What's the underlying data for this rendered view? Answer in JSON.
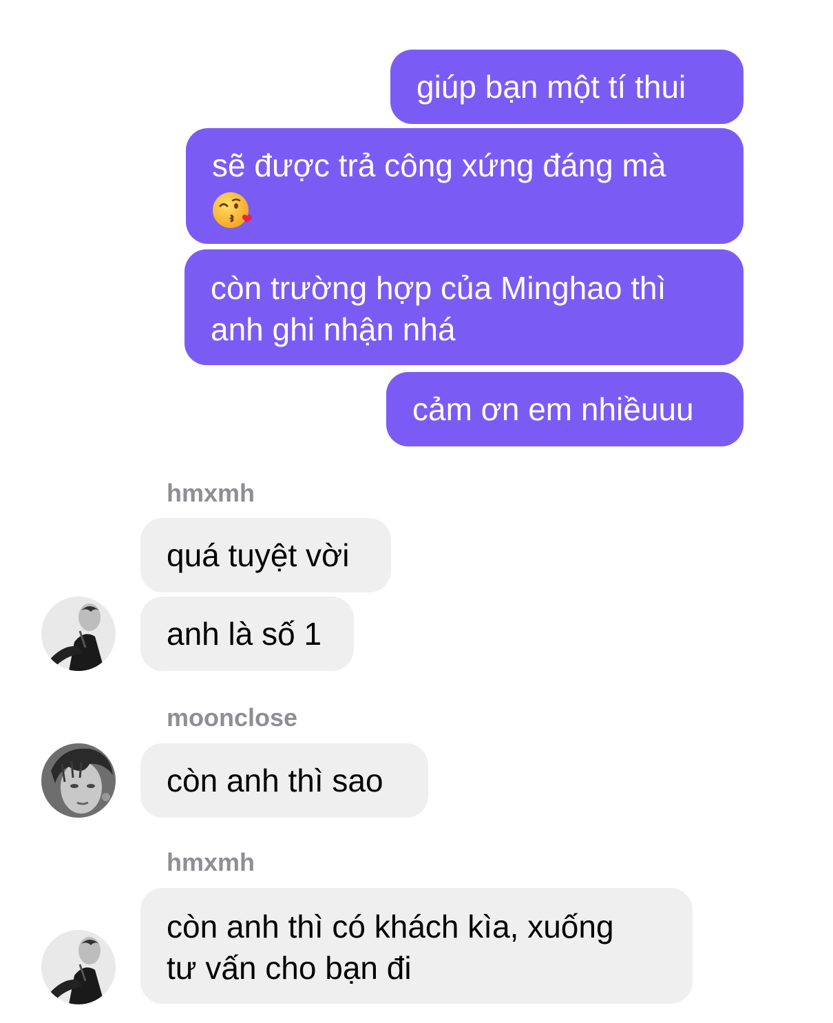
{
  "thread": {
    "outgoing": [
      {
        "text": "giúp bạn một tí thui"
      },
      {
        "text": "sẽ được trả công xứng đáng mà",
        "emoji": "kissing-face-with-heart-emoji"
      },
      {
        "line1": "còn trường hợp của Minghao thì",
        "line2": "anh ghi nhận nhá"
      },
      {
        "text": "cảm ơn em nhiềuuu"
      }
    ],
    "groups": [
      {
        "sender": "hmxmh",
        "avatar": "avatar-black-white-photo",
        "messages": [
          "quá tuyệt vời",
          "anh là số 1"
        ]
      },
      {
        "sender": "moonclose",
        "avatar": "avatar-black-white-photo",
        "messages": [
          "còn anh thì sao"
        ]
      },
      {
        "sender": "hmxmh",
        "avatar": "avatar-black-white-photo",
        "messages": [
          {
            "line1": "còn anh thì có khách kìa, xuống",
            "line2": "tư vấn cho bạn đi"
          }
        ]
      }
    ]
  },
  "colors": {
    "outgoing_bubble": "#7a5cf5",
    "incoming_bubble": "#efeff0",
    "sender_name": "#8e8e93",
    "outgoing_text": "#ffffff",
    "incoming_text": "#000000"
  }
}
